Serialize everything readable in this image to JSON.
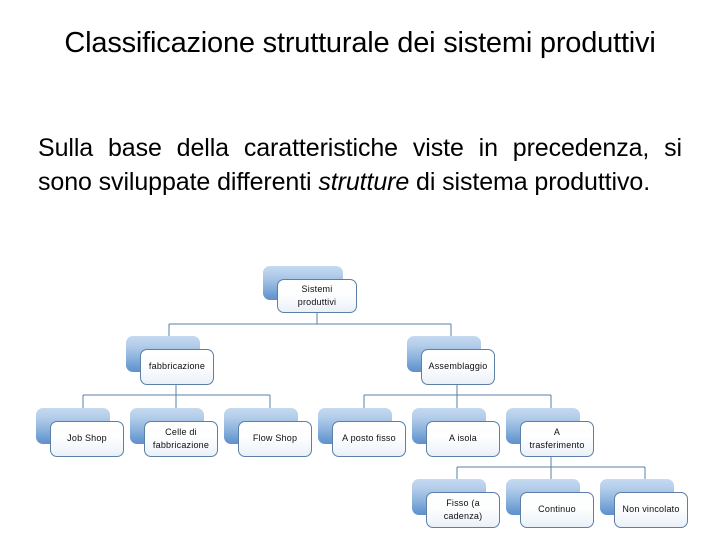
{
  "slide": {
    "title": "Classificazione strutturale dei sistemi produttivi",
    "body_part1": "Sulla base della caratteristiche viste in precedenza, si sono sviluppate differenti ",
    "body_emphasis": "strutture",
    "body_part2": " di sistema produttivo."
  },
  "diagram": {
    "type": "org-chart",
    "node_style": {
      "plate_gradient_top": "#c6daf0",
      "plate_gradient_bottom": "#628fc9",
      "card_background": "#ffffff",
      "card_border": "#5b7fa6",
      "connector_color": "#5b7fa6",
      "text_color": "#0d0d0d"
    },
    "nodes": {
      "root": "Sistemi\nproduttivi",
      "fabbricazione": "fabbricazione",
      "assemblaggio": "Assemblaggio",
      "job_shop": "Job Shop",
      "celle": "Celle di\nfabbricazione",
      "flow_shop": "Flow Shop",
      "posto_fisso": "A posto fisso",
      "isola": "A isola",
      "trasferimento": "A\ntrasferimento",
      "fisso_cadenza": "Fisso (a\ncadenza)",
      "continuo": "Continuo",
      "non_vincolato": "Non vincolato"
    },
    "hierarchy": [
      {
        "label": "Sistemi produttivi",
        "children": [
          {
            "label": "fabbricazione",
            "children": [
              {
                "label": "Job Shop"
              },
              {
                "label": "Celle di fabbricazione"
              },
              {
                "label": "Flow Shop"
              }
            ]
          },
          {
            "label": "Assemblaggio",
            "children": [
              {
                "label": "A posto fisso"
              },
              {
                "label": "A isola"
              },
              {
                "label": "A trasferimento",
                "children": [
                  {
                    "label": "Fisso (a cadenza)"
                  },
                  {
                    "label": "Continuo"
                  },
                  {
                    "label": "Non vincolato"
                  }
                ]
              }
            ]
          }
        ]
      }
    ]
  }
}
